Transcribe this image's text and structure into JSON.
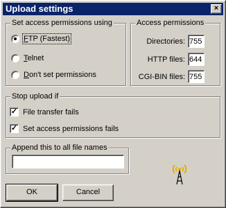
{
  "window": {
    "title": "Upload settings",
    "close_glyph": "×"
  },
  "access_group": {
    "legend": "Set access permissions using",
    "options": [
      {
        "mnemonic": "F",
        "rest": "TP (Fastest)",
        "checked": true
      },
      {
        "mnemonic": "T",
        "rest": "elnet",
        "checked": false
      },
      {
        "mnemonic": "D",
        "rest": "on't set permissions",
        "checked": false
      }
    ]
  },
  "permissions_group": {
    "legend": "Access permissions",
    "fields": [
      {
        "label": "Directories:",
        "value": "755"
      },
      {
        "label": "HTTP files:",
        "value": "644"
      },
      {
        "label": "CGI-BIN files:",
        "value": "755"
      }
    ]
  },
  "stop_group": {
    "legend": "Stop upload if",
    "options": [
      {
        "label": "File transfer fails",
        "checked": true
      },
      {
        "label": "Set access permissions fails",
        "checked": true
      }
    ]
  },
  "append_group": {
    "legend": "Append this to all file names",
    "value": ""
  },
  "buttons": {
    "ok": "OK",
    "cancel": "Cancel"
  },
  "icons": {
    "broadcast": "radio-tower-icon",
    "tower_color": "#e0b000"
  }
}
